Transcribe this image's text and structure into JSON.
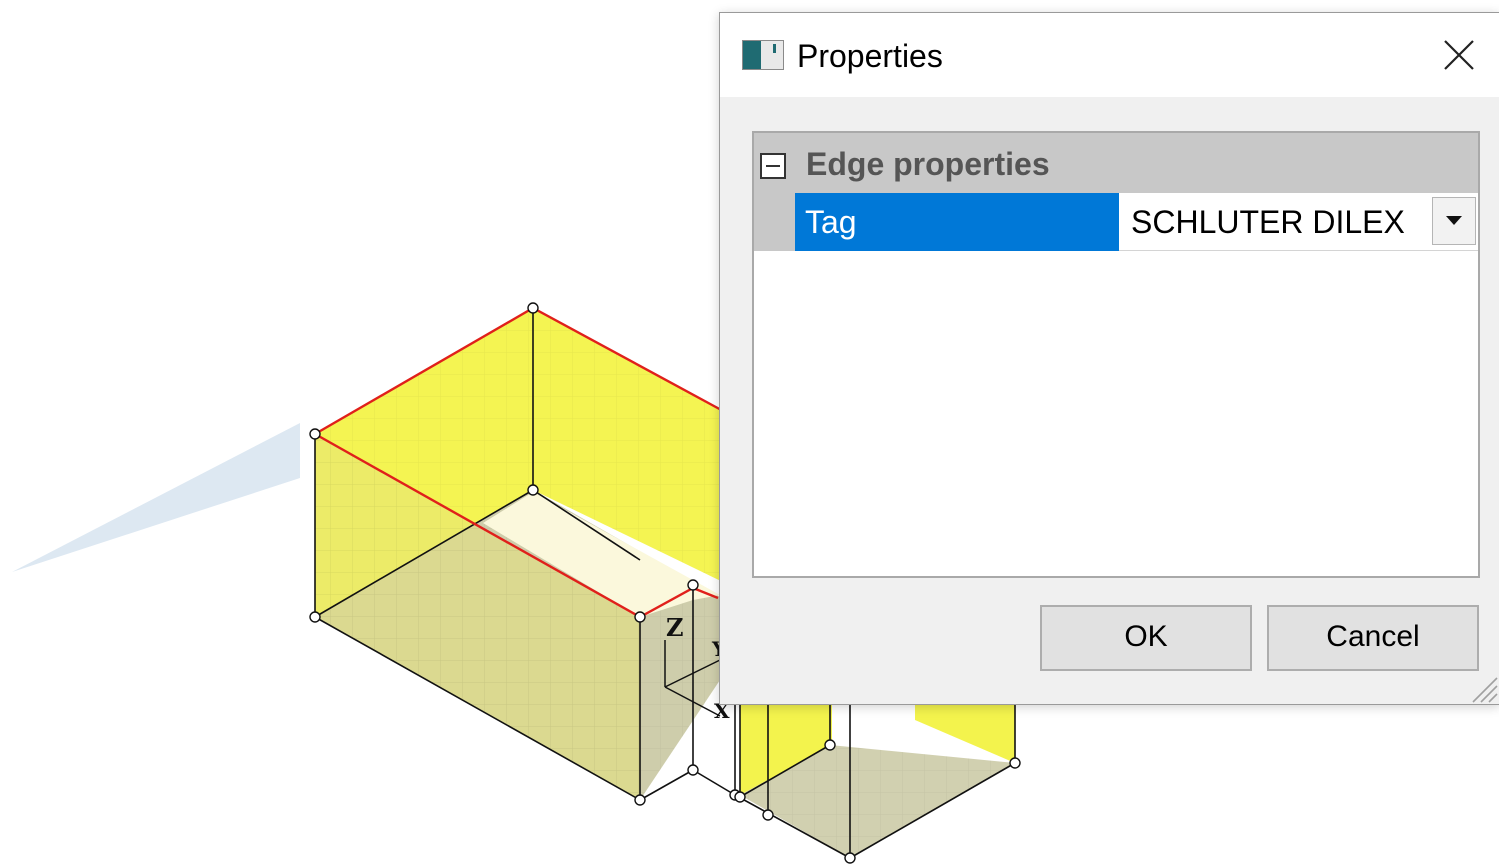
{
  "dialog": {
    "title": "Properties",
    "close_icon": "close-icon",
    "app_icon": "properties-window-icon"
  },
  "property_grid": {
    "category": {
      "label": "Edge properties",
      "expanded": true,
      "toggle_icon": "collapse-minus-icon"
    },
    "rows": [
      {
        "name": "Tag",
        "value": "SCHLUTER DILEX",
        "selected": true,
        "dropdown_icon": "dropdown-arrow-icon"
      }
    ]
  },
  "buttons": {
    "ok": "OK",
    "cancel": "Cancel"
  },
  "viewport": {
    "axis_labels": {
      "z": "Z",
      "y": "Y",
      "x": "X"
    },
    "colors": {
      "wall_fill": "#f2f23a",
      "floor_fill": "#c9c8a2",
      "selected_edge": "#e0201b",
      "edge": "#111111",
      "light_beam": "#dde8f2"
    }
  },
  "colors": {
    "selection_blue": "#0078d7",
    "category_gray": "#c8c8c8",
    "dialog_bg": "#f0f0f0"
  }
}
